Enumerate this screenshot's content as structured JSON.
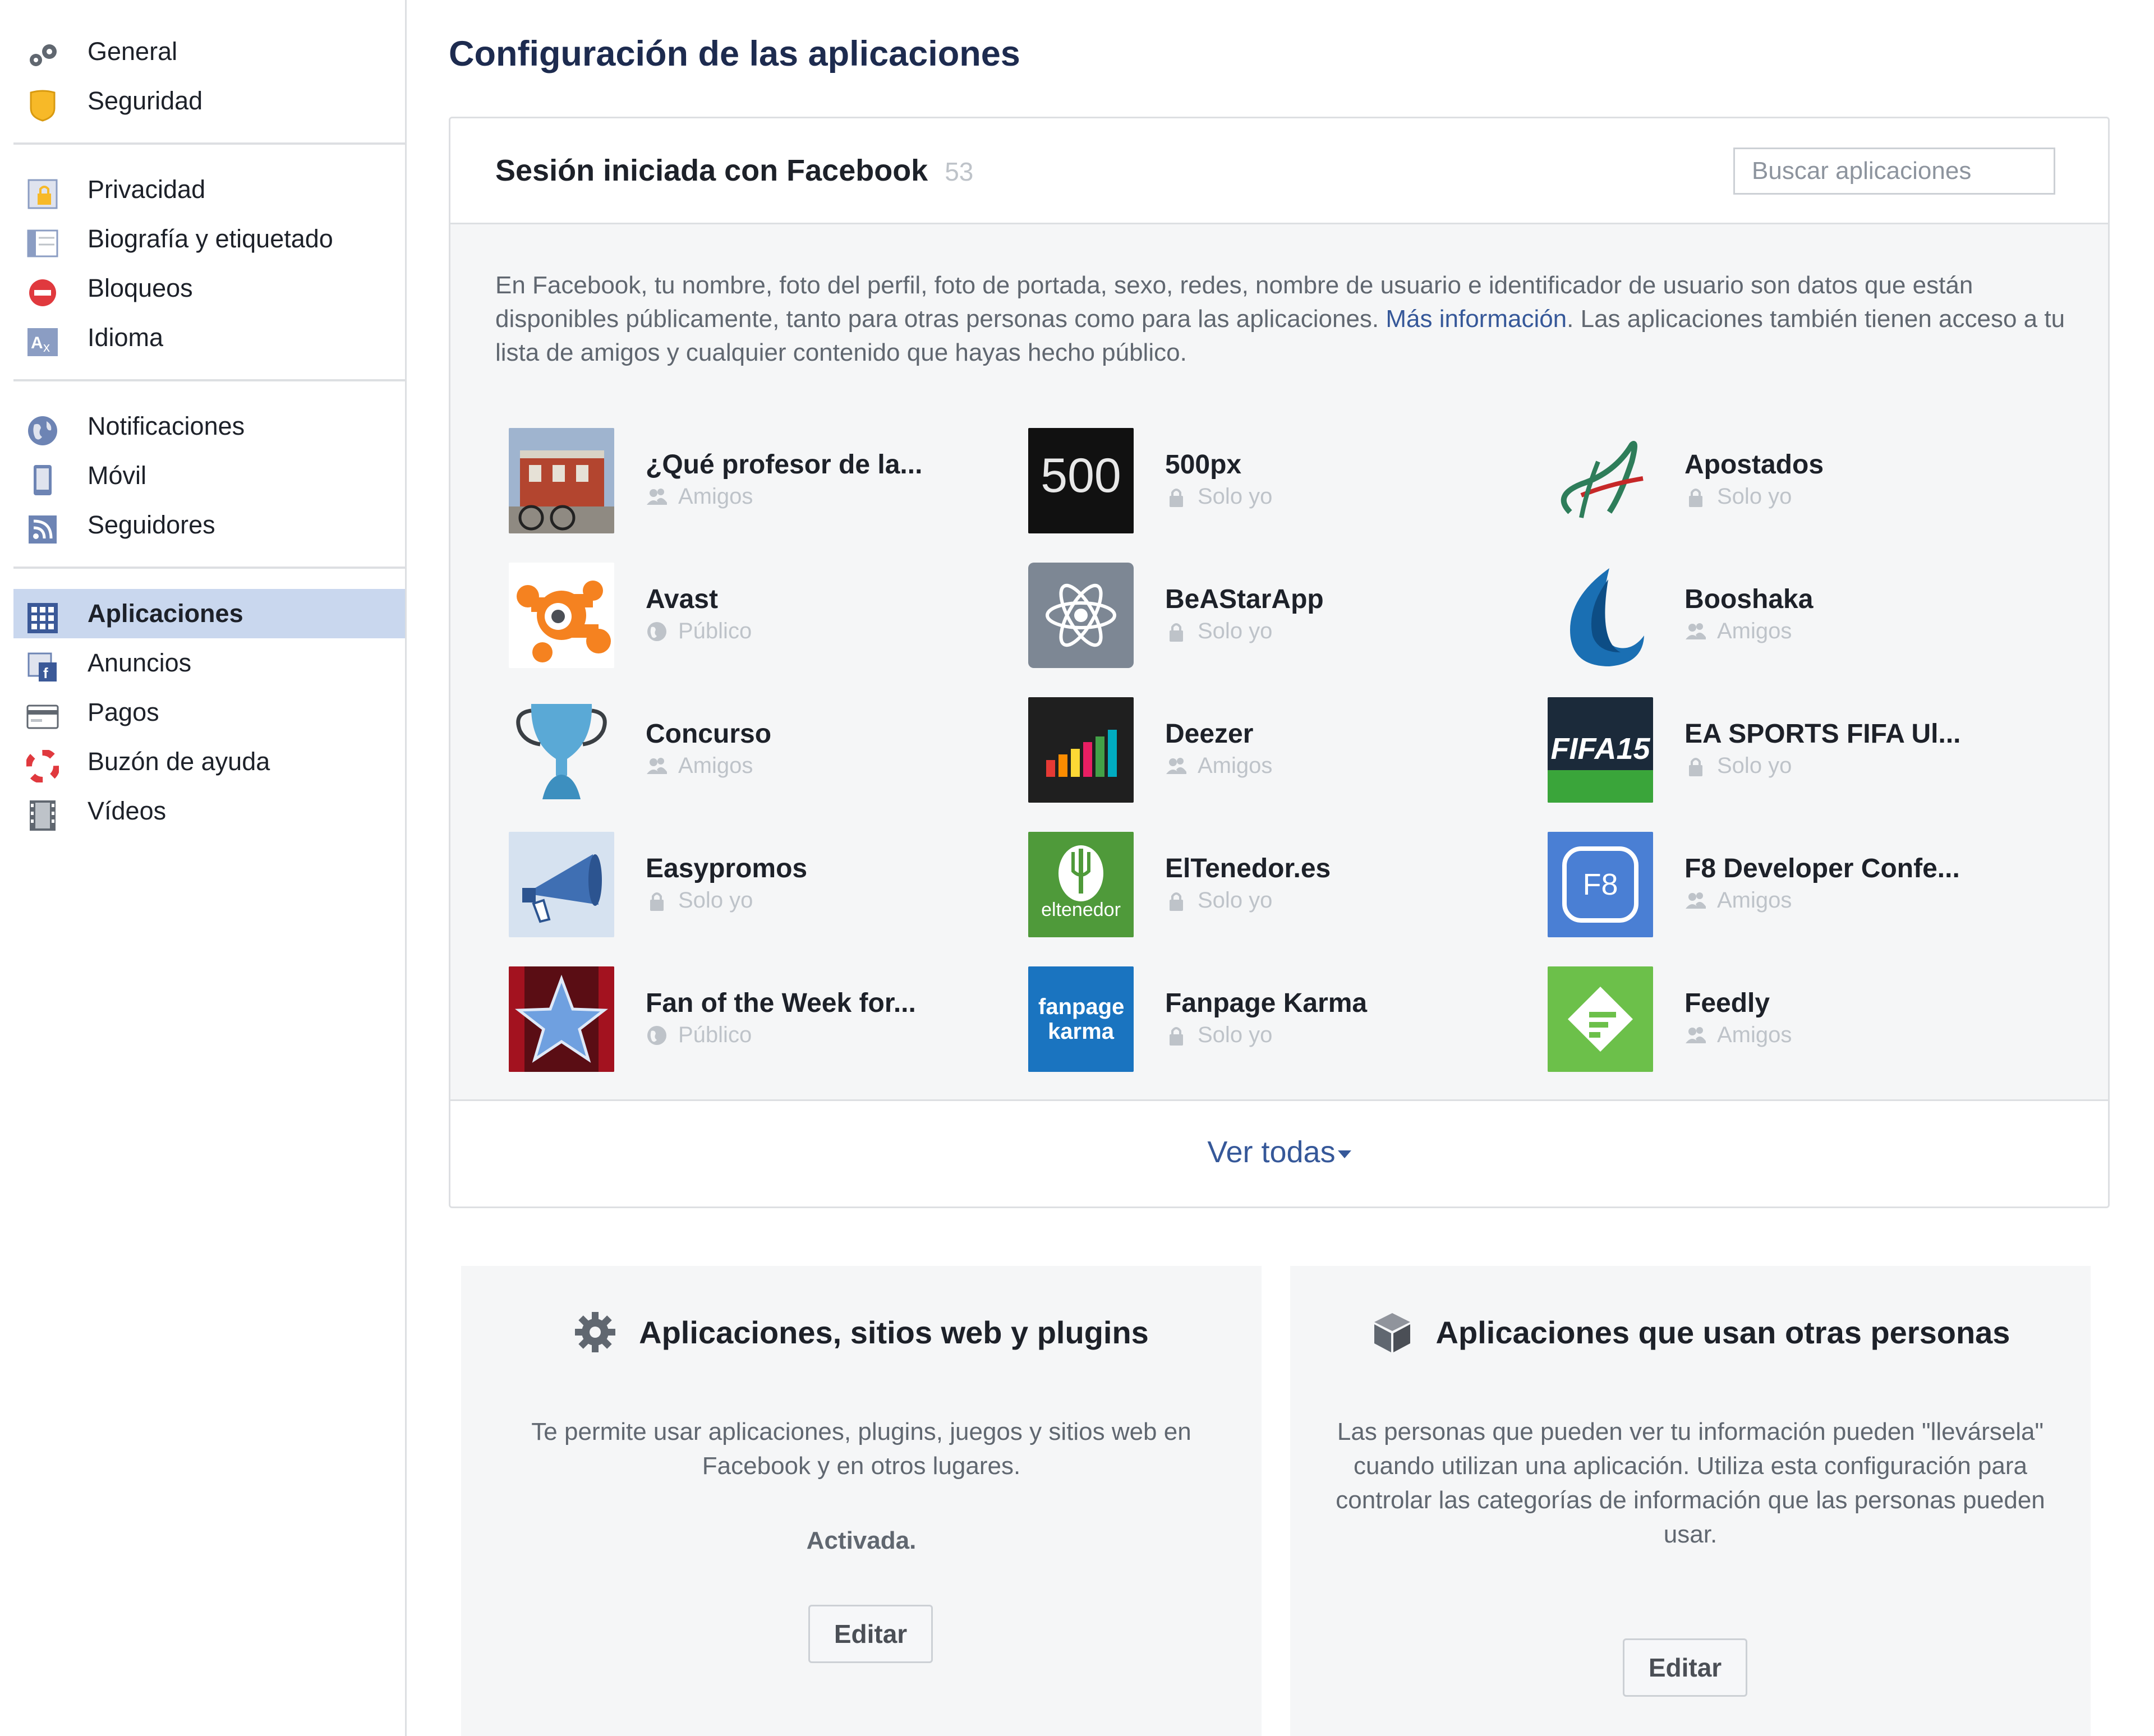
{
  "sidebar": {
    "groups": [
      [
        {
          "label": "General",
          "icon": "gears-icon"
        },
        {
          "label": "Seguridad",
          "icon": "badge-icon"
        }
      ],
      [
        {
          "label": "Privacidad",
          "icon": "lock-icon"
        },
        {
          "label": "Biografía y etiquetado",
          "icon": "timeline-icon"
        },
        {
          "label": "Bloqueos",
          "icon": "block-icon"
        },
        {
          "label": "Idioma",
          "icon": "language-icon"
        }
      ],
      [
        {
          "label": "Notificaciones",
          "icon": "globe-icon"
        },
        {
          "label": "Móvil",
          "icon": "mobile-icon"
        },
        {
          "label": "Seguidores",
          "icon": "rss-icon"
        }
      ],
      [
        {
          "label": "Aplicaciones",
          "icon": "apps-icon",
          "active": true
        },
        {
          "label": "Anuncios",
          "icon": "ads-icon"
        },
        {
          "label": "Pagos",
          "icon": "card-icon"
        },
        {
          "label": "Buzón de ayuda",
          "icon": "lifebuoy-icon"
        },
        {
          "label": "Vídeos",
          "icon": "film-icon"
        }
      ]
    ]
  },
  "page_title": "Configuración de las aplicaciones",
  "apps_panel": {
    "title": "Sesión iniciada con Facebook",
    "count": "53",
    "search_placeholder": "Buscar aplicaciones",
    "intro_before_link": "En Facebook, tu nombre, foto del perfil, foto de portada, sexo, redes, nombre de usuario e identificador de usuario son datos que están disponibles públicamente, tanto para otras personas como para las aplicaciones. ",
    "intro_link": "Más información",
    "intro_after_link": ". Las aplicaciones también tienen acceso a tu lista de amigos y cualquier contenido que hayas hecho público.",
    "see_all": "Ver todas",
    "apps": [
      {
        "name": "¿Qué profesor de la...",
        "privacy": "Amigos",
        "privacy_icon": "friends-icon",
        "thumb": "building-thumb"
      },
      {
        "name": "500px",
        "privacy": "Solo yo",
        "privacy_icon": "lock-icon",
        "thumb": "500px-logo",
        "logo_text": "500"
      },
      {
        "name": "Apostados",
        "privacy": "Solo yo",
        "privacy_icon": "lock-icon",
        "thumb": "apostados-logo"
      },
      {
        "name": "Avast",
        "privacy": "Público",
        "privacy_icon": "globe-icon",
        "thumb": "avast-logo"
      },
      {
        "name": "BeAStarApp",
        "privacy": "Solo yo",
        "privacy_icon": "lock-icon",
        "thumb": "atom-logo"
      },
      {
        "name": "Booshaka",
        "privacy": "Amigos",
        "privacy_icon": "friends-icon",
        "thumb": "booshaka-logo"
      },
      {
        "name": "Concurso",
        "privacy": "Amigos",
        "privacy_icon": "friends-icon",
        "thumb": "trophy-logo"
      },
      {
        "name": "Deezer",
        "privacy": "Amigos",
        "privacy_icon": "friends-icon",
        "thumb": "deezer-logo"
      },
      {
        "name": "EA SPORTS FIFA Ul...",
        "privacy": "Solo yo",
        "privacy_icon": "lock-icon",
        "thumb": "fifa-logo",
        "logo_text": "FIFA15"
      },
      {
        "name": "Easypromos",
        "privacy": "Solo yo",
        "privacy_icon": "lock-icon",
        "thumb": "megaphone-logo"
      },
      {
        "name": "ElTenedor.es",
        "privacy": "Solo yo",
        "privacy_icon": "lock-icon",
        "thumb": "eltenedor-logo",
        "logo_text": "eltenedor"
      },
      {
        "name": "F8 Developer Confe...",
        "privacy": "Amigos",
        "privacy_icon": "friends-icon",
        "thumb": "f8-logo",
        "logo_text": "F8"
      },
      {
        "name": "Fan of the Week for...",
        "privacy": "Público",
        "privacy_icon": "globe-icon",
        "thumb": "star-logo"
      },
      {
        "name": "Fanpage Karma",
        "privacy": "Solo yo",
        "privacy_icon": "lock-icon",
        "thumb": "fanpage-karma-logo",
        "logo_text": "fanpage karma"
      },
      {
        "name": "Feedly",
        "privacy": "Amigos",
        "privacy_icon": "friends-icon",
        "thumb": "feedly-logo"
      }
    ]
  },
  "cards": {
    "plugins": {
      "title": "Aplicaciones, sitios web y plugins",
      "icon": "gear-icon",
      "text": "Te permite usar aplicaciones, plugins, juegos y sitios web en Facebook y en otros lugares.",
      "status": "Activada.",
      "edit": "Editar"
    },
    "others": {
      "title": "Aplicaciones que usan otras personas",
      "icon": "cube-icon",
      "text": "Las personas que pueden ver tu información pueden \"llevársela\" cuando utilizan una aplicación. Utiliza esta configuración para controlar las categorías de información que las personas pueden usar.",
      "edit": "Editar"
    }
  },
  "colors": {
    "link": "#365899",
    "active_nav": "#c9d7ee",
    "panel_bg": "#f5f6f7",
    "muted_text": "#606770",
    "faint_text": "#bec3c9"
  }
}
